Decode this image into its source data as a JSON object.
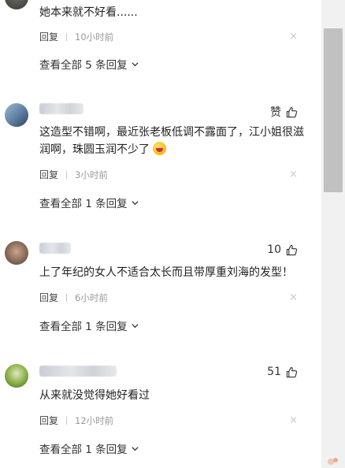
{
  "comments": [
    {
      "text": "她本来就不好看......",
      "reply_label": "回复",
      "time": "10小时前",
      "close_glyph": "×",
      "view_all": "查看全部 5 条回复"
    },
    {
      "like_label": "赞",
      "text": "这造型不错啊，最近张老板低调不露面了，江小姐很滋润啊，珠圆玉润不少了",
      "reply_label": "回复",
      "time": "3小时前",
      "close_glyph": "×",
      "view_all": "查看全部 1 条回复"
    },
    {
      "like_count": "10",
      "text": "上了年纪的女人不适合太长而且带厚重刘海的发型！",
      "reply_label": "回复",
      "time": "6小时前",
      "close_glyph": "×",
      "view_all": "查看全部 1 条回复"
    },
    {
      "like_count": "51",
      "text": "从来就没觉得她好看过",
      "reply_label": "回复",
      "time": "12小时前",
      "close_glyph": "×",
      "view_all": "查看全部 1 条回复"
    }
  ],
  "icons": {
    "like": "thumbs-up-icon",
    "expand": "chevron-down-icon",
    "emoji": "grinning-face-emoji"
  },
  "colors": {
    "text": "#222222",
    "time": "#999999",
    "close": "#c8c8c8",
    "scroll_thumb": "#c1c1c1"
  }
}
